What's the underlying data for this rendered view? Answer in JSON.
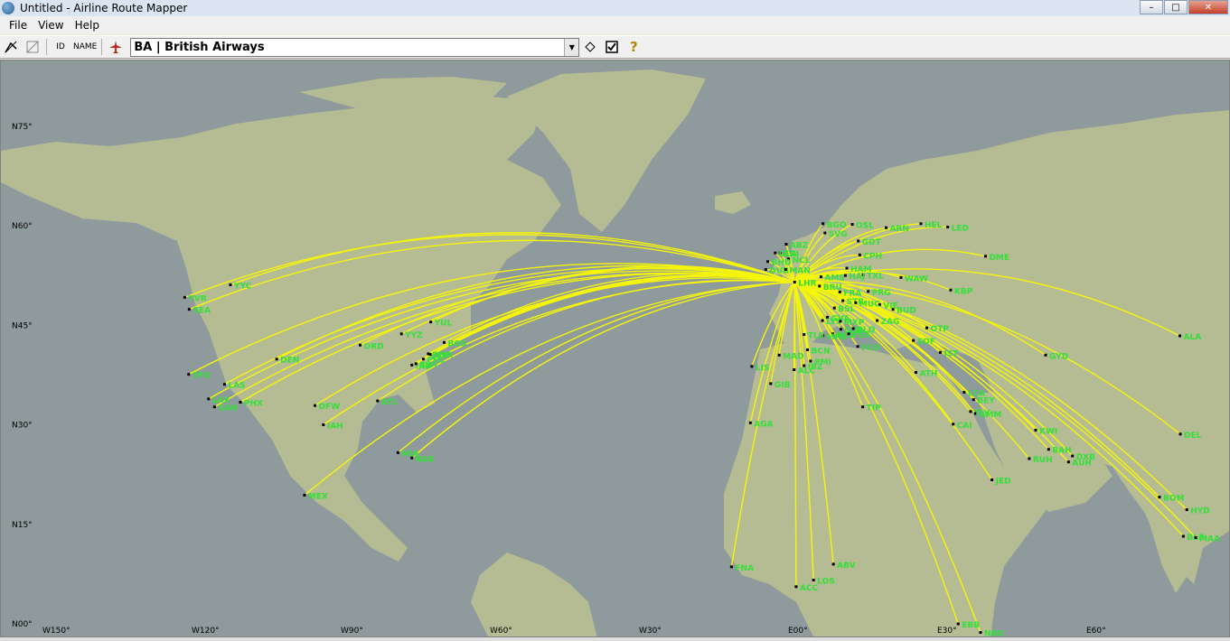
{
  "window": {
    "title": "Untitled - Airline Route Mapper",
    "minimize": "–",
    "maximize": "□",
    "close": "✕"
  },
  "menu": [
    "File",
    "View",
    "Help"
  ],
  "toolbar": {
    "id_label": "ID",
    "name_label": "NAME",
    "airline_selected": "BA | British Airways",
    "help_label": "?"
  },
  "map": {
    "hub": "LHR",
    "colors": {
      "ocean": "#8f9a9c",
      "land": "#b5bc93",
      "route": "#f5f50a",
      "label": "#33e03a",
      "dot": "#000000",
      "grid_label": "#000000"
    },
    "lat_labels": [
      "N75°",
      "N60°",
      "N45°",
      "N30°",
      "N15°",
      "N00°"
    ],
    "lon_labels": [
      "W150°",
      "W120°",
      "W90°",
      "W60°",
      "W30°",
      "E00°",
      "E30°",
      "E60°"
    ],
    "airports": [
      {
        "code": "YVR",
        "lon": -123.2,
        "lat": 49.2
      },
      {
        "code": "SEA",
        "lon": -122.3,
        "lat": 47.4
      },
      {
        "code": "YYC",
        "lon": -114.0,
        "lat": 51.1
      },
      {
        "code": "SFO",
        "lon": -122.4,
        "lat": 37.6
      },
      {
        "code": "LAS",
        "lon": -115.2,
        "lat": 36.1
      },
      {
        "code": "LAX",
        "lon": -118.4,
        "lat": 33.9
      },
      {
        "code": "SAN",
        "lon": -117.2,
        "lat": 32.7
      },
      {
        "code": "PHX",
        "lon": -112.0,
        "lat": 33.4
      },
      {
        "code": "DEN",
        "lon": -104.7,
        "lat": 39.9
      },
      {
        "code": "DFW",
        "lon": -97.0,
        "lat": 32.9
      },
      {
        "code": "IAH",
        "lon": -95.3,
        "lat": 30.0
      },
      {
        "code": "MEX",
        "lon": -99.1,
        "lat": 19.4
      },
      {
        "code": "ORD",
        "lon": -87.9,
        "lat": 42.0
      },
      {
        "code": "ATL",
        "lon": -84.4,
        "lat": 33.6
      },
      {
        "code": "YYZ",
        "lon": -79.6,
        "lat": 43.7
      },
      {
        "code": "YUL",
        "lon": -73.7,
        "lat": 45.5
      },
      {
        "code": "BOS",
        "lon": -71.0,
        "lat": 42.4
      },
      {
        "code": "EWR",
        "lon": -74.2,
        "lat": 40.7
      },
      {
        "code": "JFK",
        "lon": -73.8,
        "lat": 40.6
      },
      {
        "code": "PHL",
        "lon": -75.2,
        "lat": 39.9
      },
      {
        "code": "IAD",
        "lon": -77.5,
        "lat": 39.0
      },
      {
        "code": "BWI",
        "lon": -76.7,
        "lat": 39.2
      },
      {
        "code": "MIA",
        "lon": -80.3,
        "lat": 25.8
      },
      {
        "code": "NAS",
        "lon": -77.5,
        "lat": 25.0
      },
      {
        "code": "BGO",
        "lon": 5.2,
        "lat": 60.3
      },
      {
        "code": "SVG",
        "lon": 5.6,
        "lat": 58.9
      },
      {
        "code": "OSL",
        "lon": 11.1,
        "lat": 60.2
      },
      {
        "code": "GOT",
        "lon": 12.3,
        "lat": 57.7
      },
      {
        "code": "ARN",
        "lon": 17.9,
        "lat": 59.7
      },
      {
        "code": "HEL",
        "lon": 24.9,
        "lat": 60.3
      },
      {
        "code": "LED",
        "lon": 30.3,
        "lat": 59.8
      },
      {
        "code": "CPH",
        "lon": 12.6,
        "lat": 55.6
      },
      {
        "code": "HAM",
        "lon": 10.0,
        "lat": 53.6
      },
      {
        "code": "TXL",
        "lon": 13.3,
        "lat": 52.6
      },
      {
        "code": "HAJ",
        "lon": 9.7,
        "lat": 52.5
      },
      {
        "code": "WAW",
        "lon": 20.9,
        "lat": 52.2
      },
      {
        "code": "DME",
        "lon": 37.9,
        "lat": 55.4
      },
      {
        "code": "KBP",
        "lon": 30.9,
        "lat": 50.3
      },
      {
        "code": "PRG",
        "lon": 14.3,
        "lat": 50.1
      },
      {
        "code": "BUD",
        "lon": 19.3,
        "lat": 47.4
      },
      {
        "code": "VIE",
        "lon": 16.6,
        "lat": 48.1
      },
      {
        "code": "ZAG",
        "lon": 16.1,
        "lat": 45.7
      },
      {
        "code": "OTP",
        "lon": 26.1,
        "lat": 44.6
      },
      {
        "code": "SOF",
        "lon": 23.4,
        "lat": 42.7
      },
      {
        "code": "IST",
        "lon": 28.8,
        "lat": 40.9
      },
      {
        "code": "ATH",
        "lon": 23.9,
        "lat": 37.9
      },
      {
        "code": "FCO",
        "lon": 12.2,
        "lat": 41.8
      },
      {
        "code": "TIP",
        "lon": 13.2,
        "lat": 32.7
      },
      {
        "code": "ABZ",
        "lon": -2.2,
        "lat": 57.2
      },
      {
        "code": "EDI",
        "lon": -3.4,
        "lat": 55.9
      },
      {
        "code": "GLA",
        "lon": -4.4,
        "lat": 55.9
      },
      {
        "code": "NCL",
        "lon": -1.7,
        "lat": 55.0
      },
      {
        "code": "BHD",
        "lon": -5.9,
        "lat": 54.6
      },
      {
        "code": "DUB",
        "lon": -6.3,
        "lat": 53.4
      },
      {
        "code": "MAN",
        "lon": -2.3,
        "lat": 53.4
      },
      {
        "code": "LHR",
        "lon": -0.5,
        "lat": 51.5
      },
      {
        "code": "AMS",
        "lon": 4.8,
        "lat": 52.3
      },
      {
        "code": "BRU",
        "lon": 4.5,
        "lat": 50.9
      },
      {
        "code": "FRA",
        "lon": 8.6,
        "lat": 50.0
      },
      {
        "code": "STR",
        "lon": 9.2,
        "lat": 48.7
      },
      {
        "code": "MUC",
        "lon": 11.8,
        "lat": 48.4
      },
      {
        "code": "GVA",
        "lon": 6.1,
        "lat": 46.2
      },
      {
        "code": "BSL",
        "lon": 7.5,
        "lat": 47.6
      },
      {
        "code": "LYS",
        "lon": 5.1,
        "lat": 45.7
      },
      {
        "code": "NCE",
        "lon": 7.2,
        "lat": 43.7
      },
      {
        "code": "MRS",
        "lon": 5.2,
        "lat": 43.4
      },
      {
        "code": "GOA",
        "lon": 8.8,
        "lat": 44.4
      },
      {
        "code": "MXP",
        "lon": 8.7,
        "lat": 45.6
      },
      {
        "code": "BLQ",
        "lon": 11.3,
        "lat": 44.5
      },
      {
        "code": "PSA",
        "lon": 10.4,
        "lat": 43.7
      },
      {
        "code": "TLS",
        "lon": 1.4,
        "lat": 43.6
      },
      {
        "code": "BCN",
        "lon": 2.1,
        "lat": 41.3
      },
      {
        "code": "PMI",
        "lon": 2.7,
        "lat": 39.6
      },
      {
        "code": "MAD",
        "lon": -3.6,
        "lat": 40.5
      },
      {
        "code": "ALC",
        "lon": -0.6,
        "lat": 38.3
      },
      {
        "code": "IBZ",
        "lon": 1.4,
        "lat": 38.9
      },
      {
        "code": "LIS",
        "lon": -9.1,
        "lat": 38.8
      },
      {
        "code": "GIB",
        "lon": -5.3,
        "lat": 36.2
      },
      {
        "code": "AGA",
        "lon": -9.4,
        "lat": 30.3
      },
      {
        "code": "LCA",
        "lon": 33.6,
        "lat": 34.9
      },
      {
        "code": "BEY",
        "lon": 35.5,
        "lat": 33.8
      },
      {
        "code": "AMM",
        "lon": 35.9,
        "lat": 31.7
      },
      {
        "code": "TLV",
        "lon": 34.9,
        "lat": 32.0
      },
      {
        "code": "CAI",
        "lon": 31.4,
        "lat": 30.1
      },
      {
        "code": "BAH",
        "lon": 50.6,
        "lat": 26.3
      },
      {
        "code": "KWI",
        "lon": 48.0,
        "lat": 29.2
      },
      {
        "code": "RUH",
        "lon": 46.7,
        "lat": 24.9
      },
      {
        "code": "DXB",
        "lon": 55.4,
        "lat": 25.3
      },
      {
        "code": "AUH",
        "lon": 54.6,
        "lat": 24.4
      },
      {
        "code": "JED",
        "lon": 39.2,
        "lat": 21.7
      },
      {
        "code": "GYD",
        "lon": 50.0,
        "lat": 40.5
      },
      {
        "code": "ALA",
        "lon": 77.0,
        "lat": 43.4
      },
      {
        "code": "DEL",
        "lon": 77.1,
        "lat": 28.6
      },
      {
        "code": "BOM",
        "lon": 72.9,
        "lat": 19.1
      },
      {
        "code": "HYD",
        "lon": 78.4,
        "lat": 17.2
      },
      {
        "code": "BLR",
        "lon": 77.7,
        "lat": 13.2
      },
      {
        "code": "MAA",
        "lon": 80.2,
        "lat": 13.0
      },
      {
        "code": "FNA",
        "lon": -13.2,
        "lat": 8.6
      },
      {
        "code": "ACC",
        "lon": -0.2,
        "lat": 5.6
      },
      {
        "code": "LOS",
        "lon": 3.3,
        "lat": 6.6
      },
      {
        "code": "ABV",
        "lon": 7.3,
        "lat": 9.0
      },
      {
        "code": "EBB",
        "lon": 32.4,
        "lat": 0.0
      },
      {
        "code": "NBO",
        "lon": 36.9,
        "lat": -1.3
      }
    ]
  }
}
